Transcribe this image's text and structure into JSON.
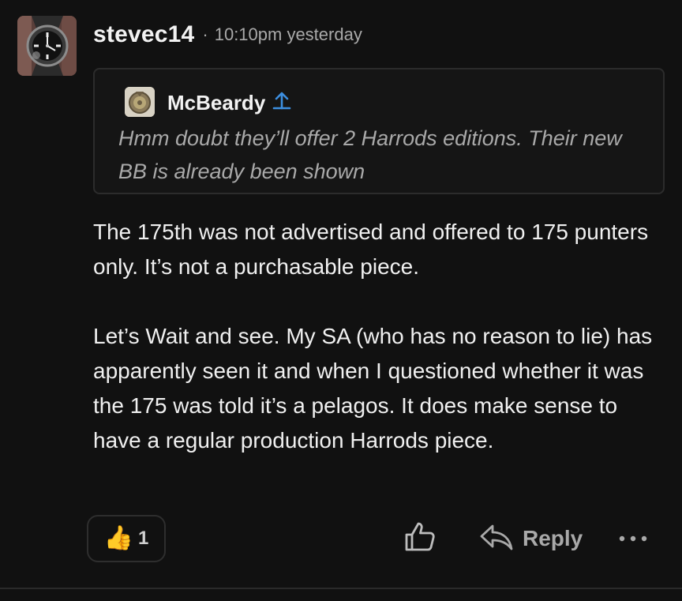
{
  "post": {
    "author": "stevec14",
    "separator": "·",
    "timestamp": "10:10pm yesterday",
    "avatar_icon": "watch-avatar-icon",
    "quote": {
      "author": "McBeardy",
      "avatar_icon": "medal-avatar-icon",
      "jump_icon": "arrow-up-icon",
      "text": "Hmm doubt they’ll offer 2 Harrods editions. Their new BB is already been shown"
    },
    "body": {
      "paragraph_1": "The 175th was not advertised and offered to 175 punters only. It’s not a purchasable piece.",
      "paragraph_2": "Let’s Wait and see. My SA (who has no reason to lie) has apparently seen it and when I questioned whether it was the 175 was told it’s a pelagos. It does make sense to have a regular production Harrods piece."
    },
    "actions": {
      "reaction_emoji": "👍",
      "reaction_count": "1",
      "like_icon": "thumbs-up-outline-icon",
      "reply_icon": "reply-arrow-icon",
      "reply_label": "Reply",
      "more_icon": "more-dots-icon"
    }
  },
  "colors": {
    "background": "#111111",
    "text_primary": "#f0f0f0",
    "text_secondary": "#a9a9a9",
    "accent": "#3d8fe0",
    "border": "#2c2c2c"
  }
}
